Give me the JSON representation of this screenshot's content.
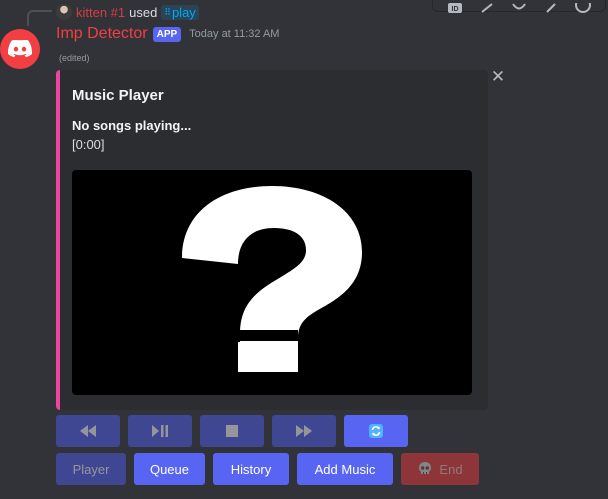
{
  "reply": {
    "username": "kitten #1",
    "used_text": "used",
    "command": "play"
  },
  "message": {
    "author": "Imp Detector",
    "tag": "APP",
    "timestamp": "Today at 11:32 AM",
    "edited_label": "(edited)"
  },
  "embed": {
    "title": "Music Player",
    "status": "No songs playing...",
    "time": "[0:00]",
    "image_glyph": "?",
    "accent_color": "#eb459e"
  },
  "controls_row": [
    {
      "name": "rewind-button",
      "icon": "rewind-icon",
      "enabled": false
    },
    {
      "name": "play-pause-button",
      "icon": "play-pause-icon",
      "enabled": false
    },
    {
      "name": "stop-button",
      "icon": "stop-icon",
      "enabled": false
    },
    {
      "name": "fast-forward-button",
      "icon": "fast-forward-icon",
      "enabled": false
    },
    {
      "name": "loop-button",
      "icon": "loop-icon",
      "enabled": true
    }
  ],
  "nav_row": {
    "player": "Player",
    "queue": "Queue",
    "history": "History",
    "add_music": "Add Music",
    "end": "End"
  },
  "toolbar_icons": [
    "id-icon",
    "link-icon",
    "reply-icon",
    "pin-icon",
    "emoji-icon"
  ]
}
